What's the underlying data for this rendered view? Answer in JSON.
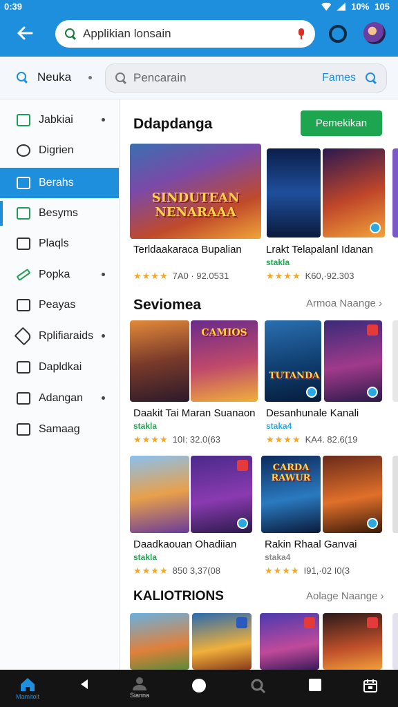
{
  "status_bar": {
    "time": "0:39",
    "battery": "10%",
    "extra": "105"
  },
  "top_bar": {
    "search_value": "Applikian lonsain"
  },
  "row2": {
    "label": "Neuka",
    "search_placeholder": "Pencarain",
    "search_link": "Fames"
  },
  "sidebar": {
    "items": [
      {
        "label": "Jabkiai",
        "icon": "clipboard-icon",
        "dot": true,
        "active": false
      },
      {
        "label": "Digrien",
        "icon": "search-person-icon",
        "dot": false,
        "active": false
      },
      {
        "label": "Berahs",
        "icon": "chart-icon",
        "dot": false,
        "active": true
      },
      {
        "label": "Besyms",
        "icon": "trend-icon",
        "dot": false,
        "active": false
      },
      {
        "label": "Plaqls",
        "icon": "check-box-icon",
        "dot": false,
        "active": false
      },
      {
        "label": "Popka",
        "icon": "pencil-icon",
        "dot": true,
        "active": false
      },
      {
        "label": "Peayas",
        "icon": "person-box-icon",
        "dot": false,
        "active": false
      },
      {
        "label": "Rplifiaraids",
        "icon": "tag-icon",
        "dot": true,
        "active": false
      },
      {
        "label": "Dapldkai",
        "icon": "calendar-icon",
        "dot": false,
        "active": false
      },
      {
        "label": "Adangan",
        "icon": "list-icon",
        "dot": true,
        "active": false
      },
      {
        "label": "Samaag",
        "icon": "inbox-icon",
        "dot": false,
        "active": false
      }
    ]
  },
  "sections": [
    {
      "title": "Ddapdanga",
      "action_label": "Pemekikan",
      "cards": [
        {
          "logo": "SINDUTEAN NENARAAA",
          "title": "Terldaakaraca Bupalian",
          "rating_text": "7A0 · 92.0531",
          "stars": "★★★★",
          "sub": ""
        },
        {
          "logo": "",
          "title": "Lrakt Telapalanl Idanan",
          "rating_text": "K60,·92.303",
          "stars": "★★★★",
          "sub": "stakla"
        }
      ]
    },
    {
      "title": "Seviomea",
      "more_label": "Armoa Naange",
      "cards": [
        {
          "logo": "CAMIOS",
          "title": "Daakit Tai Maran Suanaon",
          "rating_text": "10I: 32.0(63",
          "stars": "★★★★",
          "sub": "stakla"
        },
        {
          "logo": "TUTANDA",
          "title": "Desanhunale Kanali",
          "rating_text": "KA4. 82.6(19",
          "stars": "★★★★",
          "sub": "staka4"
        },
        {
          "logo": "",
          "title": "Daadkaouan Ohadiian",
          "rating_text": "850 3,37(08",
          "stars": "★★★★",
          "sub": "stakla"
        },
        {
          "logo": "CARDA RAWUR",
          "title": "Rakin Rhaal Ganvai",
          "rating_text": "I91,·02 I0(3",
          "stars": "★★★★",
          "sub": "staka4"
        }
      ]
    },
    {
      "title": "KALIOTRIONS",
      "more_label": "Aolage Naange"
    }
  ],
  "bottom_nav": {
    "home_label": "Mamitolt",
    "profile_label": "Sianna"
  },
  "colors": {
    "primary": "#1e8fdc",
    "accent_green": "#1ea54f",
    "star": "#f5a623"
  }
}
